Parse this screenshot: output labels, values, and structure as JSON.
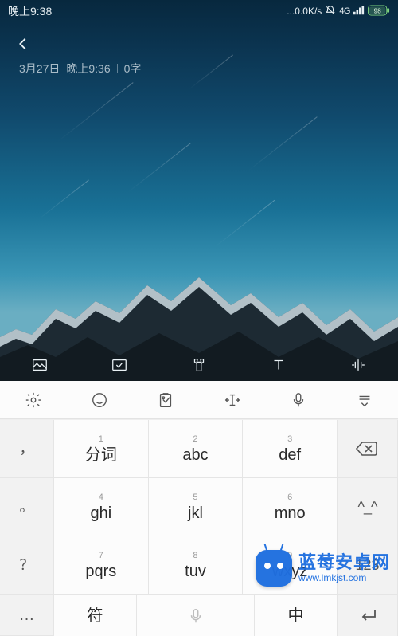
{
  "status": {
    "time": "晚上9:38",
    "net": "...0.0K/s",
    "sig": "4G",
    "battery": "98"
  },
  "note": {
    "meta_date": "3月27日",
    "meta_time": "晚上9:36",
    "meta_words": "0字"
  },
  "ime": {
    "keys": {
      "k1": {
        "num": "1",
        "label": "分词"
      },
      "k2": {
        "num": "2",
        "label": "abc"
      },
      "k3": {
        "num": "3",
        "label": "def"
      },
      "k4": {
        "num": "4",
        "label": "ghi"
      },
      "k5": {
        "num": "5",
        "label": "jkl"
      },
      "k6": {
        "num": "6",
        "label": "mno"
      },
      "k7": {
        "num": "7",
        "label": "pqrs"
      },
      "k8": {
        "num": "8",
        "label": "tuv"
      },
      "k9": {
        "num": "9",
        "label": "wxyz"
      }
    },
    "side": {
      "comma": "，",
      "period": "。",
      "question": "？",
      "exclaim": "！",
      "more": "…"
    },
    "right": {
      "kaomoji": "^_^",
      "num": "123"
    },
    "bottom": {
      "symbol": "符",
      "lang": "中"
    }
  },
  "watermark": {
    "title": "蓝莓安卓网",
    "url": "www.lmkjst.com"
  }
}
